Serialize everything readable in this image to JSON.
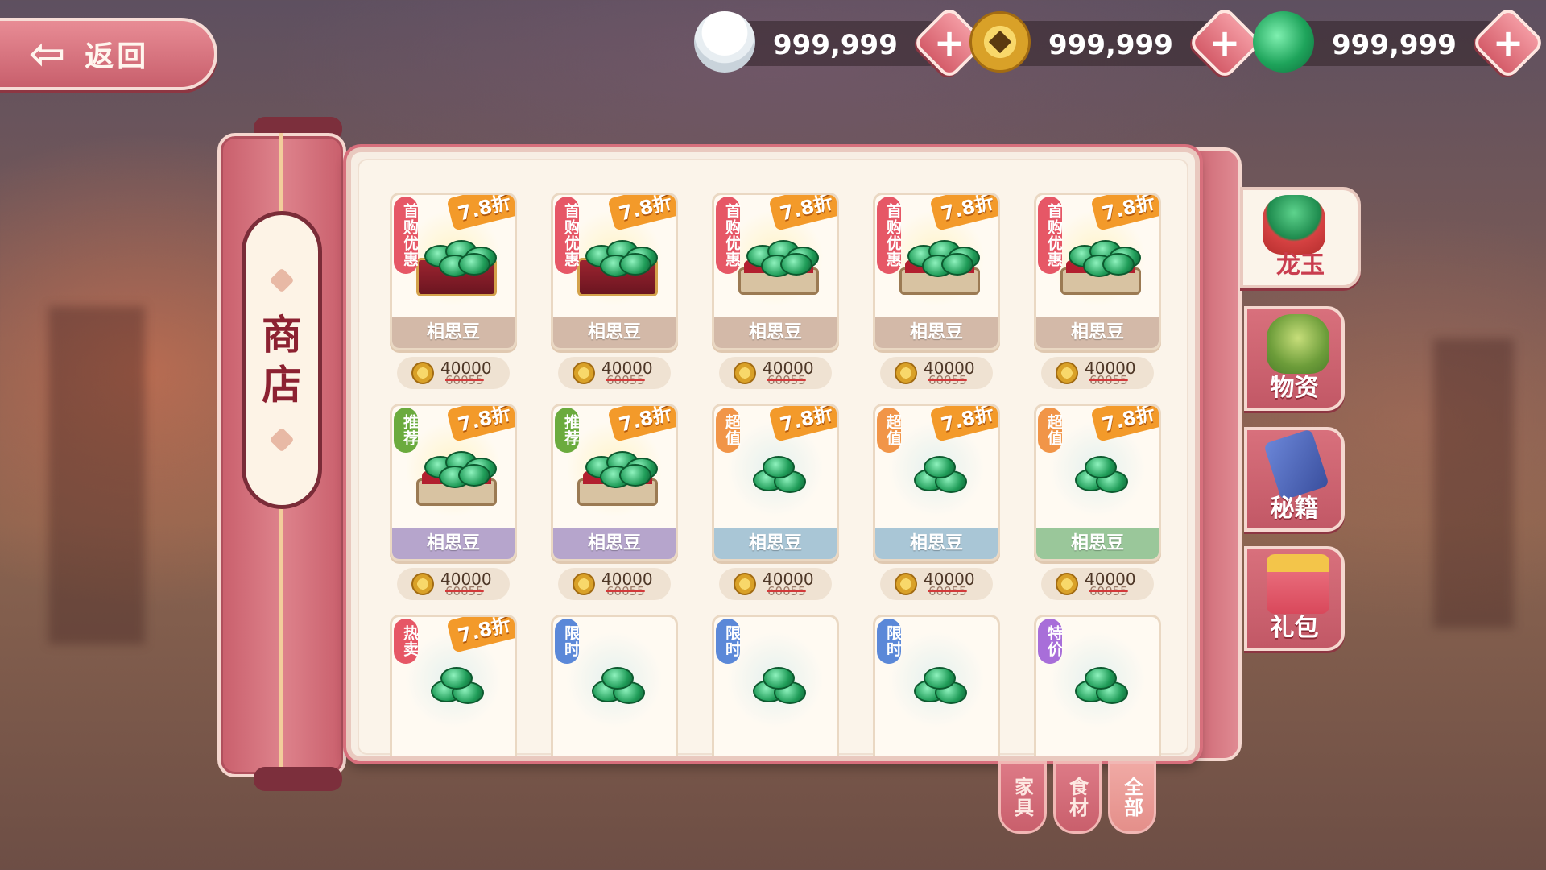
{
  "nav": {
    "back_label": "返回"
  },
  "currencies": [
    {
      "icon": "rice-bowl-icon",
      "value": "999,999"
    },
    {
      "icon": "copper-coin-icon",
      "value": "999,999"
    },
    {
      "icon": "jade-dragon-icon",
      "value": "999,999"
    }
  ],
  "shop": {
    "title_1": "商",
    "title_2": "店"
  },
  "items": [
    {
      "tag": "首购优惠",
      "tag_color": "red",
      "discount": "7.8折",
      "name": "相思豆",
      "price": "40000",
      "old_price": "60055",
      "art": "chest",
      "name_style": "tan"
    },
    {
      "tag": "首购优惠",
      "tag_color": "red",
      "discount": "7.8折",
      "name": "相思豆",
      "price": "40000",
      "old_price": "60055",
      "art": "chest",
      "name_style": "tan"
    },
    {
      "tag": "首购优惠",
      "tag_color": "red",
      "discount": "7.8折",
      "name": "相思豆",
      "price": "40000",
      "old_price": "60055",
      "art": "tray",
      "name_style": "tan"
    },
    {
      "tag": "首购优惠",
      "tag_color": "red",
      "discount": "7.8折",
      "name": "相思豆",
      "price": "40000",
      "old_price": "60055",
      "art": "tray",
      "name_style": "tan"
    },
    {
      "tag": "首购优惠",
      "tag_color": "red",
      "discount": "7.8折",
      "name": "相思豆",
      "price": "40000",
      "old_price": "60055",
      "art": "tray",
      "name_style": "tan"
    },
    {
      "tag": "推荐",
      "tag_color": "green",
      "discount": "7.8折",
      "name": "相思豆",
      "price": "40000",
      "old_price": "60055",
      "art": "tray",
      "name_style": "purple"
    },
    {
      "tag": "推荐",
      "tag_color": "green",
      "discount": "7.8折",
      "name": "相思豆",
      "price": "40000",
      "old_price": "60055",
      "art": "tray",
      "name_style": "purple"
    },
    {
      "tag": "超值",
      "tag_color": "orange",
      "discount": "7.8折",
      "name": "相思豆",
      "price": "40000",
      "old_price": "60055",
      "art": "coil",
      "name_style": "blue"
    },
    {
      "tag": "超值",
      "tag_color": "orange",
      "discount": "7.8折",
      "name": "相思豆",
      "price": "40000",
      "old_price": "60055",
      "art": "coil",
      "name_style": "blue"
    },
    {
      "tag": "超值",
      "tag_color": "orange",
      "discount": "7.8折",
      "name": "相思豆",
      "price": "40000",
      "old_price": "60055",
      "art": "coil",
      "name_style": "green"
    },
    {
      "tag": "热卖",
      "tag_color": "red",
      "discount": "7.8折",
      "name": "",
      "price": "",
      "old_price": "",
      "art": "coil",
      "name_style": ""
    },
    {
      "tag": "限时",
      "tag_color": "blue",
      "discount": "",
      "name": "",
      "price": "",
      "old_price": "",
      "art": "coil",
      "name_style": ""
    },
    {
      "tag": "限时",
      "tag_color": "blue",
      "discount": "",
      "name": "",
      "price": "",
      "old_price": "",
      "art": "coil",
      "name_style": ""
    },
    {
      "tag": "限时",
      "tag_color": "blue",
      "discount": "",
      "name": "",
      "price": "",
      "old_price": "",
      "art": "coil",
      "name_style": ""
    },
    {
      "tag": "特价",
      "tag_color": "purple",
      "discount": "",
      "name": "",
      "price": "",
      "old_price": "",
      "art": "coil",
      "name_style": ""
    }
  ],
  "side_tabs": [
    {
      "label": "龙玉",
      "icon": "jade-bag-icon",
      "active": true
    },
    {
      "label": "物资",
      "icon": "supply-bag-icon",
      "active": false
    },
    {
      "label": "秘籍",
      "icon": "book-icon",
      "active": false
    },
    {
      "label": "礼包",
      "icon": "gift-box-icon",
      "active": false
    }
  ],
  "filter_tabs": [
    {
      "label": "家具",
      "active": false
    },
    {
      "label": "食材",
      "active": false
    },
    {
      "label": "全部",
      "active": true
    }
  ]
}
